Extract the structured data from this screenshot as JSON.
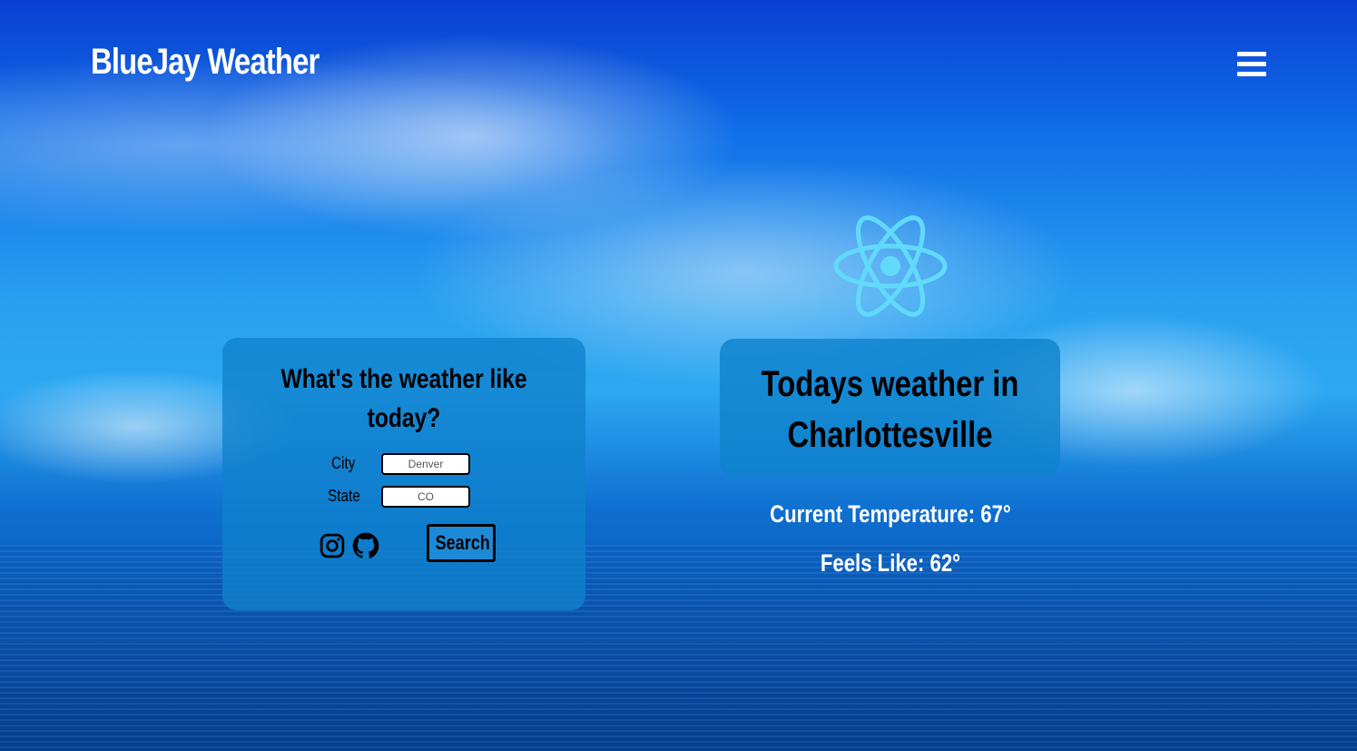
{
  "header": {
    "brand": "BlueJay Weather",
    "menu_icon": "hamburger-menu-icon"
  },
  "search_card": {
    "title_line1": "What's the weather like",
    "title_line2": "today?",
    "city_label": "City",
    "city_placeholder": "Denver",
    "state_label": "State",
    "state_placeholder": "CO",
    "instagram_icon": "instagram-icon",
    "github_icon": "github-icon",
    "search_label": "Search"
  },
  "weather": {
    "logo_icon": "react-logo-icon",
    "title_line1": "Todays weather in",
    "title_line2": "Charlottesville",
    "current_temp": "Current Temperature: 67°",
    "feels_like": "Feels Like: 62°"
  },
  "colors": {
    "card_bg": "#1082cd",
    "react_logo": "#61dafb",
    "text_light": "#ffffff",
    "text_dark": "#000000"
  }
}
